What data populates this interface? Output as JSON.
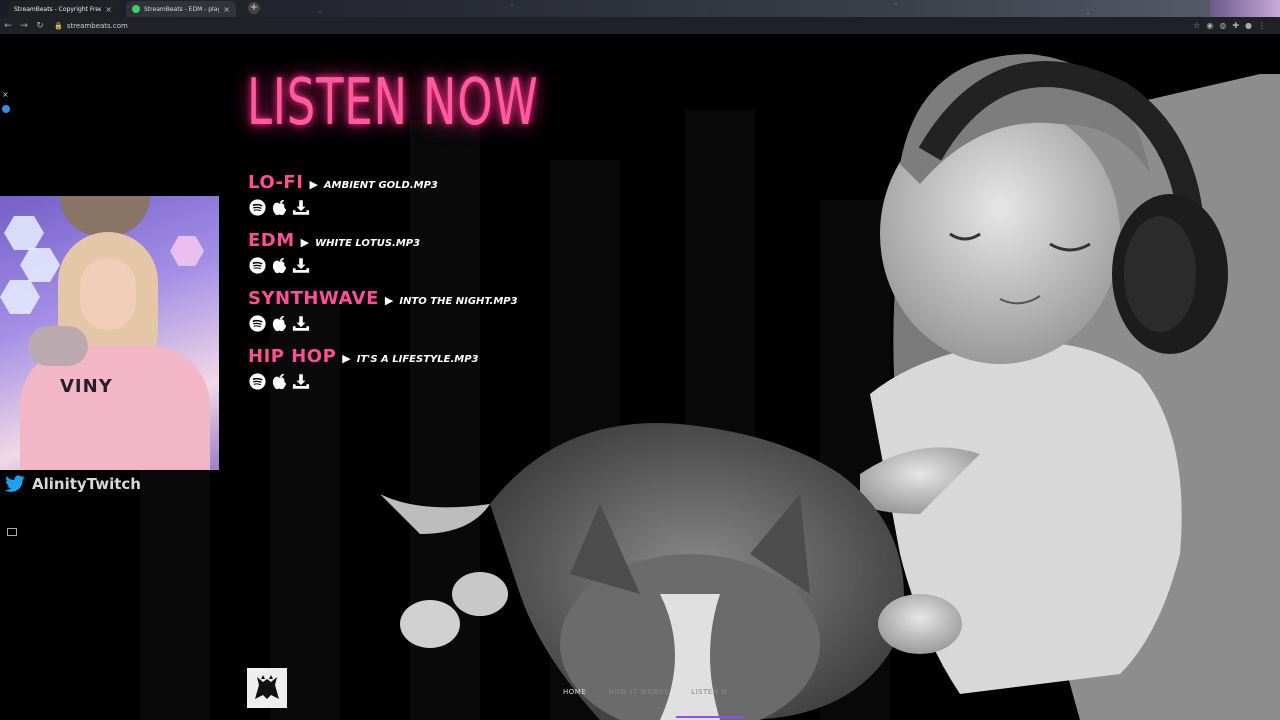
{
  "browser": {
    "tabs": [
      {
        "title": "StreamBeats - Copyright Free M",
        "active": true
      },
      {
        "title": "StreamBeats - EDM - playlist by",
        "active": false
      }
    ],
    "new_tab": "+",
    "close": "×",
    "url": "streambeats.com"
  },
  "stream": {
    "handle": "AlinityTwitch",
    "sweater_text": "VINY"
  },
  "page": {
    "headline": "LISTEN NOW",
    "tracks": [
      {
        "genre": "LO-FI",
        "song": "AMBIENT GOLD.MP3"
      },
      {
        "genre": "EDM",
        "song": "WHITE LOTUS.MP3"
      },
      {
        "genre": "SYNTHWAVE",
        "song": "INTO THE NIGHT.MP3"
      },
      {
        "genre": "HIP HOP",
        "song": "IT'S A LIFESTYLE.MP3"
      }
    ],
    "play_glyph": "▶",
    "footer_nav": [
      {
        "label": "HOME"
      },
      {
        "label": "HOW IT WORKS"
      },
      {
        "label": "LISTEN N"
      }
    ]
  },
  "colors": {
    "accent_pink": "#ff4f95",
    "neon_glow": "#ff2d84",
    "background": "#000000"
  },
  "icons": [
    "spotify-icon",
    "apple-icon",
    "download-icon",
    "twitter-icon",
    "wolf-logo-icon"
  ]
}
